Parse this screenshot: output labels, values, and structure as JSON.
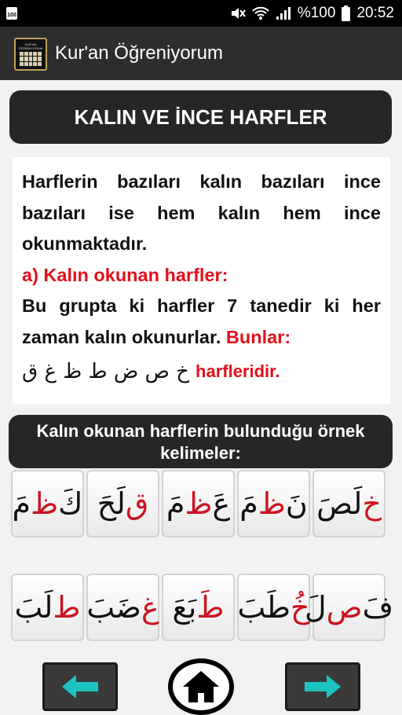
{
  "status_bar": {
    "small_battery": "100",
    "battery_text": "%100",
    "time": "20:52"
  },
  "app_bar": {
    "title": "Kur'an Öğreniyorum",
    "logo_text": "KUR'AN ÖĞRENIYORUM"
  },
  "lesson": {
    "header": "KALIN VE İNCE HARFLER",
    "intro": "Harflerin bazıları kalın bazıları ince bazıları ise hem kalın hem ince okunmaktadır.",
    "section_a": "a) Kalın okunan harfler:",
    "body_1": "Bu grupta ki harfler 7 tanedir ki her zaman kalın okunurlar.",
    "body_2": "Bunlar:",
    "letters": "خ ص ض ط ظ غ ق",
    "letters_suffix": "harfleridir."
  },
  "examples": {
    "title": "Kalın okunan harflerin bulunduğu örnek kelimeler:",
    "row_1": [
      {
        "pre": "",
        "red": "خ",
        "post": "لَصَ"
      },
      {
        "pre": "نَ",
        "red": "ظ",
        "post": "مَ"
      },
      {
        "pre": "عَ",
        "red": "ظ",
        "post": "مَ"
      },
      {
        "pre": "",
        "red": "ق",
        "post": "لَحَ"
      },
      {
        "pre": "كَ",
        "red": "ظ",
        "post": "مَ"
      }
    ],
    "row_2": [
      {
        "pre": "فَ",
        "red": "ص",
        "post": "لَ"
      },
      {
        "pre": "",
        "red": "خُ",
        "post": "طَبَ"
      },
      {
        "pre": "",
        "red": "طَ",
        "post": "بَعَ"
      },
      {
        "pre": "",
        "red": "غ",
        "post": "ضَبَ"
      },
      {
        "pre": "",
        "red": "ط",
        "post": "لَبَ"
      }
    ]
  },
  "navigation": {
    "back": "back-arrow-icon",
    "home": "home-icon",
    "forward": "forward-arrow-icon"
  },
  "colors": {
    "accent_red": "#e3101c",
    "arrow_cyan": "#1cc3c1",
    "card_dark": "#262626"
  }
}
